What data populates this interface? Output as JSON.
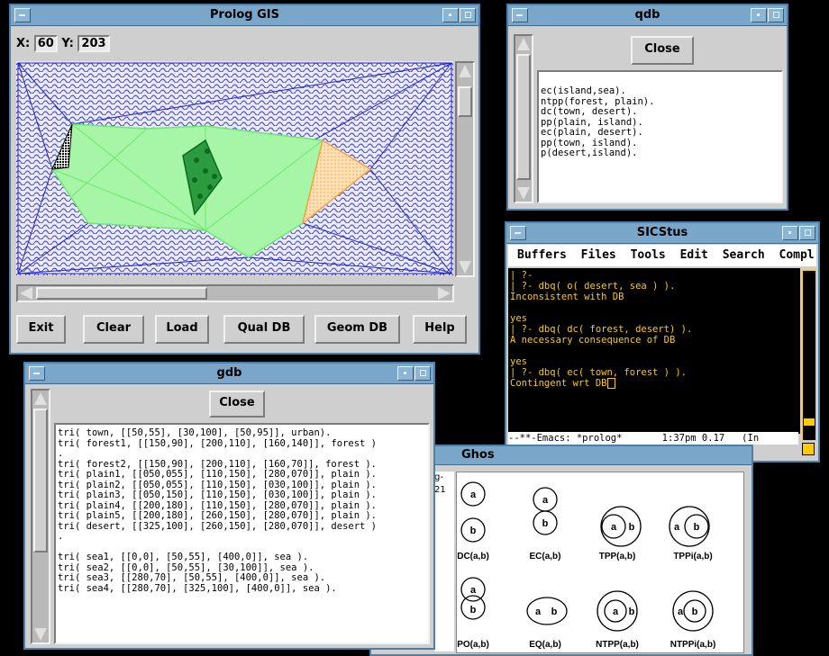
{
  "gis": {
    "title": "Prolog GIS",
    "x_label": "X:",
    "x_value": "60",
    "y_label": "Y:",
    "y_value": "203",
    "buttons": [
      "Exit",
      "Clear",
      "Load",
      "Qual DB",
      "Geom DB",
      "Help"
    ]
  },
  "qdb": {
    "title": "qdb",
    "close_label": "Close",
    "lines": [
      "ec(island,sea).",
      "ntpp(forest, plain).",
      "dc(town, desert).",
      "pp(plain, island).",
      "ec(plain, desert).",
      "pp(town, island).",
      "p(desert,island)."
    ]
  },
  "sicstus": {
    "title": "SICStus",
    "menu": [
      "Buffers",
      "Files",
      "Tools",
      "Edit",
      "Search",
      "Compl"
    ],
    "lines": [
      "| ?-",
      "| ?- dbq( o( desert, sea ) ).",
      "Inconsistent with DB",
      "",
      "yes",
      "| ?- dbq( dc( forest, desert) ).",
      "A necessary consequence of DB",
      "",
      "yes",
      "| ?- dbq( ec( town, forest ) ).",
      "Contingent wrt DB"
    ],
    "modeline": "--**-Emacs: *prolog*       1:37pm 0.17   (In"
  },
  "gdb": {
    "title": "gdb",
    "close_label": "Close",
    "lines": [
      "tri( town, [[50,55], [30,100], [50,95]], urban).",
      "tri( forest1, [[150,90], [200,110], [160,140]], forest )",
      ".",
      "tri( forest2, [[150,90], [200,110], [160,70]], forest ).",
      "tri( plain1, [[050,055], [110,150], [280,070]], plain ).",
      "tri( plain2, [[050,055], [110,150], [030,100]], plain ).",
      "tri( plain3, [[050,150], [110,150], [030,100]], plain ).",
      "tri( plain4, [[200,180], [110,150], [280,070]], plain ).",
      "tri( plain5, [[200,180], [260,150], [280,070]], plain ).",
      "tri( desert, [[325,100], [260,150], [280,070]], desert )",
      ".",
      "",
      "tri( sea1, [[0,0], [50,55], [400,0]], sea ).",
      "tri( sea2, [[0,0], [50,55], [30,100]], sea ).",
      "tri( sea3, [[280,70], [50,55], [400,0]], sea ).",
      "tri( sea4, [[280,70], [325,100], [400,0]], sea )."
    ]
  },
  "ghost": {
    "title": "Ghos",
    "left_fragment": [
      "g-",
      "21"
    ],
    "relations": [
      "DC(a,b)",
      "EC(a,b)",
      "TPP(a,b)",
      "TPPi(a,b)",
      "PO(a,b)",
      "EQ(a,b)",
      "NTPP(a,b)",
      "NTPPi(a,b)"
    ],
    "label_a": "a",
    "label_b": "b"
  },
  "colors": {
    "title_bar": "#7aa7c9",
    "window_border": "#4e7fa6",
    "sea": "#3b3bd6",
    "plain": "#6ee66e",
    "desert": "#f4a341",
    "forest": "#0a6b1e",
    "emacs_text": "#ffcc00"
  }
}
